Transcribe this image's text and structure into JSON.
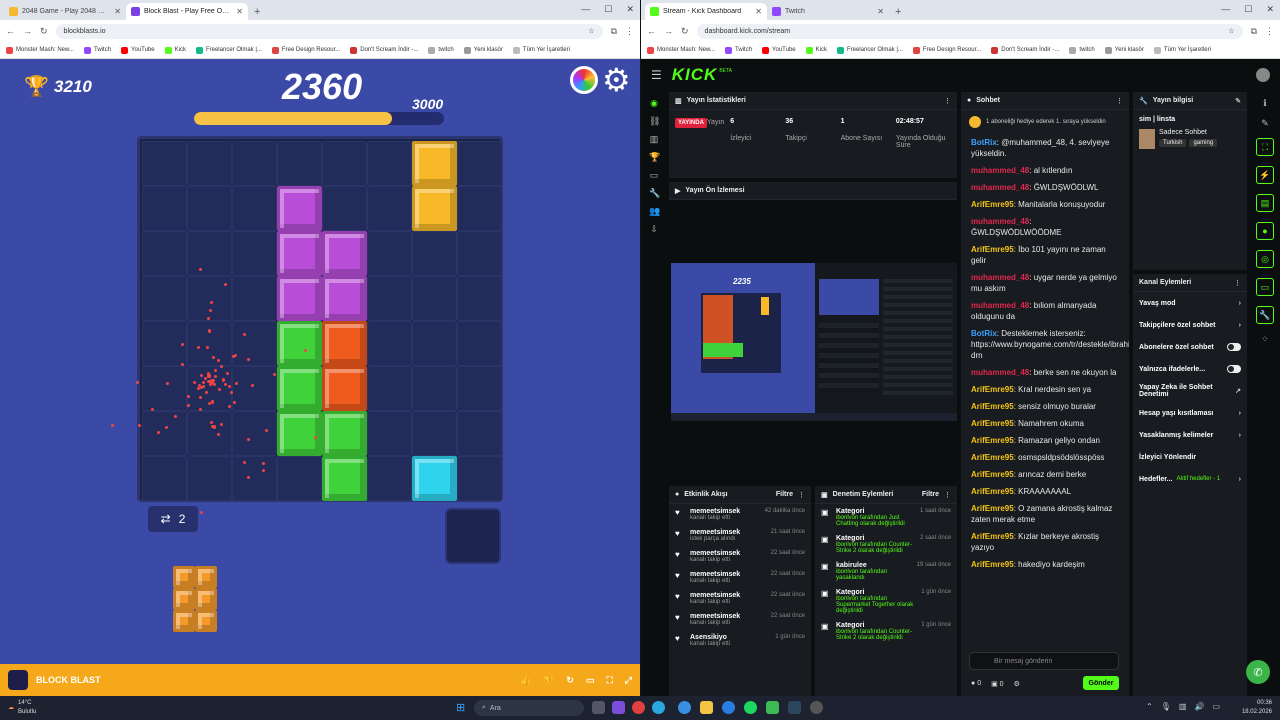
{
  "left_window": {
    "tabs": [
      {
        "label": "2048 Game - Play 2048 Game ...",
        "favicon_color": "#f5b82e"
      },
      {
        "label": "Block Blast - Play Free Onli...",
        "favicon_color": "#7b3fe4"
      }
    ],
    "url": "blockblasts.io",
    "bookmarks": [
      "Monster Mash: New...",
      "Twitch",
      "YouTube",
      "Kick",
      "Freelancer Olmak |...",
      "Free Design Resour...",
      "Don't Scream İndir -...",
      "twitch",
      "Yeni klasör",
      "Tüm Yer İşaretleri"
    ]
  },
  "game": {
    "best_score": "3210",
    "score": "2360",
    "target": "3000",
    "progress": 0.79,
    "undo_count": "2",
    "footer_title": "BLOCK BLAST",
    "colors": {
      "purple": "#b84ed8",
      "green": "#3fd23a",
      "orange": "#ef5a1d",
      "yellow": "#f7b928",
      "cyan": "#2fd3ee",
      "tray": "#f49a2a"
    }
  },
  "right_window": {
    "tabs": [
      {
        "label": "Stream - Kick Dashboard",
        "favicon_color": "#53fc18"
      },
      {
        "label": "Twitch",
        "favicon_color": "#9146ff"
      }
    ],
    "url": "dashboard.kick.com/stream",
    "bookmarks": [
      "Monster Mash: New...",
      "Twitch",
      "YouTube",
      "Kick",
      "Freelancer Olmak |...",
      "Free Design Resour...",
      "Don't Scream İndir -...",
      "twitch",
      "Yeni klasör",
      "Tüm Yer İşaretleri"
    ]
  },
  "kick": {
    "logo": "KICK",
    "logo_badge": "BETA",
    "stats_title": "Yayın İstatistikleri",
    "live_label": "YAYINDA",
    "stats": [
      {
        "value": "",
        "label": "Yayın"
      },
      {
        "value": "6",
        "label": "İzleyici"
      },
      {
        "value": "36",
        "label": "Takipçi"
      },
      {
        "value": "1",
        "label": "Abone Sayısı"
      },
      {
        "value": "02:48:57",
        "label": "Yayında Olduğu Süre"
      }
    ],
    "preview_title": "Yayın Ön İzlemesi",
    "preview_score": "2235",
    "activity_title": "Etkinlik Akışı",
    "mod_title": "Denetim Eylemleri",
    "filter": "Filtre",
    "activity": [
      {
        "user": "memeetsimsek",
        "text": "kanalı takip etti",
        "time": "42 dakika önce"
      },
      {
        "user": "memeetsimsek",
        "text": "istek parça alındı",
        "time": "21 saat önce"
      },
      {
        "user": "memeetsimsek",
        "text": "kanalı takip etti",
        "time": "22 saat önce"
      },
      {
        "user": "memeetsimsek",
        "text": "kanalı takip etti",
        "time": "22 saat önce"
      },
      {
        "user": "memeetsimsek",
        "text": "kanalı takip etti",
        "time": "22 saat önce"
      },
      {
        "user": "memeetsimsek",
        "text": "kanalı takip etti",
        "time": "22 saat önce"
      },
      {
        "user": "Asensikiyo",
        "text": "kanalı takip etti",
        "time": "1 gün önce"
      }
    ],
    "mod": [
      {
        "title": "Kategori",
        "text": "ibonlvon tarafından Just Chatting olarak değiştirildi",
        "time": "1 saat önce"
      },
      {
        "title": "Kategori",
        "text": "ibonlvon tarafından Counter-Strike 2 olarak değiştirildi",
        "time": "2 saat önce"
      },
      {
        "title": "kabirulee",
        "text": "ibonlvon tarafından yasaklandı",
        "time": "19 saat önce"
      },
      {
        "title": "Kategori",
        "text": "ibonlvon tarafından Supermarket Together olarak değiştirildi",
        "time": "1 gün önce"
      },
      {
        "title": "Kategori",
        "text": "ibonlvon tarafından Counter-Strike 2 olarak değiştirildi",
        "time": "1 gün önce"
      }
    ],
    "chat_title": "Sohbet",
    "chat_pinned": "1 aboneliği hediye ederek 1. sıraya yükseldin",
    "chat": [
      {
        "user": "BotRix",
        "cls": "u3",
        "msg": "@muhammed_48, 4. seviyeye yükseldin."
      },
      {
        "user": "muhammed_48",
        "cls": "u2",
        "msg": "al kıtlendın"
      },
      {
        "user": "muhammed_48",
        "cls": "u2",
        "msg": "ĞWLDŞWÖDLWL"
      },
      {
        "user": "ArifEmre95",
        "cls": "u1",
        "msg": "Manitalarla konuşuyodur"
      },
      {
        "user": "muhammed_48",
        "cls": "u2",
        "msg": "ĞWLDŞWÖDLWÖÖDME"
      },
      {
        "user": "ArifEmre95",
        "cls": "u1",
        "msg": "İbo 101 yayını ne zaman gelir"
      },
      {
        "user": "muhammed_48",
        "cls": "u2",
        "msg": "uygar nerde ya gelmiyo mu askım"
      },
      {
        "user": "muhammed_48",
        "cls": "u2",
        "msg": "bıliom almanyada oldugunu da"
      },
      {
        "user": "BotRix",
        "cls": "u3",
        "msg": "Desteklemek isterseniz: https://www.bynogame.com/tr/destekle/ibrahim-drn"
      },
      {
        "user": "muhammed_48",
        "cls": "u2",
        "msg": "berke sen ne okuyon la"
      },
      {
        "user": "ArifEmre95",
        "cls": "u1",
        "msg": "Kral nerdesin sen ya"
      },
      {
        "user": "ArifEmre95",
        "cls": "u1",
        "msg": "sensiz olmuyo buralar"
      },
      {
        "user": "ArifEmre95",
        "cls": "u1",
        "msg": "Namahrem okuma"
      },
      {
        "user": "ArifEmre95",
        "cls": "u1",
        "msg": "Ramazan geliyo ondan"
      },
      {
        "user": "ArifEmre95",
        "cls": "u1",
        "msg": "osmspsldpsödslösspöss"
      },
      {
        "user": "ArifEmre95",
        "cls": "u1",
        "msg": "arıncaz demi berke"
      },
      {
        "user": "ArifEmre95",
        "cls": "u1",
        "msg": "KRAAAAAAAL"
      },
      {
        "user": "ArifEmre95",
        "cls": "u1",
        "msg": "O zamana akrostiş kalmaz zaten merak etme"
      },
      {
        "user": "ArifEmre95",
        "cls": "u1",
        "msg": "Kızlar berkeye akrostiş yazıyo"
      },
      {
        "user": "ArifEmre95",
        "cls": "u1",
        "msg": "hakediyo kardeşim"
      }
    ],
    "chat_placeholder": "Bir mesaj gönderin",
    "send_label": "Gönder",
    "chat_counts": [
      "0",
      "0"
    ],
    "info_title": "Yayın bilgisi",
    "stream_title": "sim | linsta",
    "stream_sub": "Sadece Sohbet",
    "tags": [
      "Turkish",
      "gaming"
    ],
    "actions_title": "Kanal Eylemleri",
    "actions": [
      {
        "label": "Yavaş mod",
        "type": "arrow"
      },
      {
        "label": "Takipçilere özel sohbet",
        "type": "arrow"
      },
      {
        "label": "Abonelere özel sohbet",
        "type": "toggle"
      },
      {
        "label": "Yalnızca ifadelerle...",
        "type": "toggle"
      },
      {
        "label": "Yapay Zeka ile Sohbet Denetimi",
        "type": "link"
      },
      {
        "label": "Hesap yaşı kısıtlaması",
        "type": "arrow"
      },
      {
        "label": "Yasaklanmış kelimeler",
        "type": "arrow"
      },
      {
        "label": "İzleyici Yönlendir",
        "type": "none"
      },
      {
        "label": "Hedefler...",
        "type": "arrow",
        "extra": "Aktif hedefler - 1"
      }
    ]
  },
  "taskbar": {
    "weather_temp": "14°C",
    "weather_text": "Bulutlu",
    "search": "Ara",
    "time": "00:36",
    "date": "18.02.2026"
  }
}
